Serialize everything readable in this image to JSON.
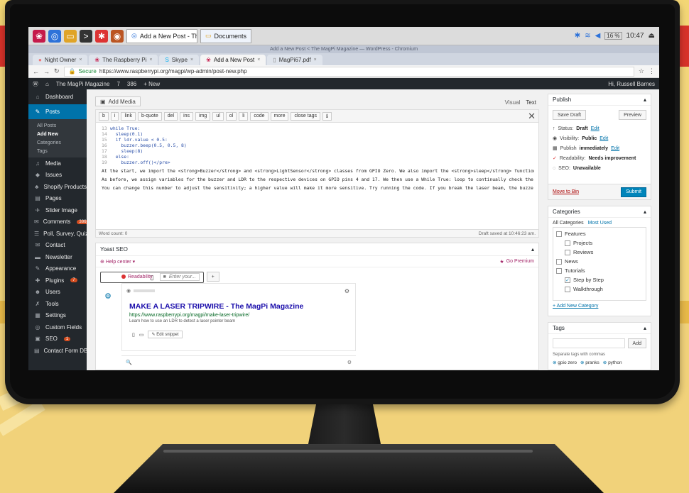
{
  "taskbar": {
    "tasks": [
      "Add a New Post - Th...",
      "Documents"
    ],
    "clock": "10:47",
    "lang": "16 %"
  },
  "browser": {
    "window_title": "Add a New Post < The MagPi Magazine — WordPress - Chromium",
    "tabs": [
      {
        "label": "Night Owner"
      },
      {
        "label": "The Raspberry Pi"
      },
      {
        "label": "Skype"
      },
      {
        "label": "Add a New Post"
      },
      {
        "label": "MagPi67.pdf"
      }
    ],
    "secure_label": "Secure",
    "url": "https://www.raspberrypi.org/magpi/wp-admin/post-new.php"
  },
  "wpbar": {
    "site": "The MagPi Magazine",
    "updates": "7",
    "comments": "386",
    "new": "+ New",
    "greeting": "Hi, Russell Barnes"
  },
  "sidebar": {
    "items": [
      {
        "icon": "⌂",
        "label": "Dashboard"
      },
      {
        "icon": "✎",
        "label": "Posts"
      }
    ],
    "posts_sub": [
      "All Posts",
      "Add New",
      "Categories",
      "Tags"
    ],
    "items2": [
      {
        "icon": "♫",
        "label": "Media"
      },
      {
        "icon": "◆",
        "label": "Issues"
      },
      {
        "icon": "♣",
        "label": "Shopify Products"
      },
      {
        "icon": "▤",
        "label": "Pages"
      },
      {
        "icon": "✈",
        "label": "Slider Image"
      },
      {
        "icon": "✉",
        "label": "Comments",
        "badge": "386"
      },
      {
        "icon": "☰",
        "label": "Poll, Survey, Quiz & Form"
      },
      {
        "icon": "✉",
        "label": "Contact"
      },
      {
        "icon": "▬",
        "label": "Newsletter"
      },
      {
        "icon": "✎",
        "label": "Appearance"
      },
      {
        "icon": "✚",
        "label": "Plugins",
        "badge": "7"
      },
      {
        "icon": "☻",
        "label": "Users"
      },
      {
        "icon": "✗",
        "label": "Tools"
      },
      {
        "icon": "▦",
        "label": "Settings"
      },
      {
        "icon": "◎",
        "label": "Custom Fields"
      },
      {
        "icon": "▣",
        "label": "SEO",
        "badge": "1"
      },
      {
        "icon": "▤",
        "label": "Contact Form DB"
      }
    ]
  },
  "editor": {
    "add_media": "Add Media",
    "tab_visual": "Visual",
    "tab_text": "Text",
    "quicktags": [
      "b",
      "i",
      "link",
      "b-quote",
      "del",
      "ins",
      "img",
      "ul",
      "ol",
      "li",
      "code",
      "more",
      "close tags",
      "ℹ"
    ],
    "code_lines": [
      {
        "n": "13",
        "t": "while True:"
      },
      {
        "n": "14",
        "t": "  sleep(0.1)"
      },
      {
        "n": "15",
        "t": "  if ldr.value < 0.5:"
      },
      {
        "n": "16",
        "t": "    buzzer.beep(0.5, 0.5, 8)"
      },
      {
        "n": "17",
        "t": "    sleep(8)"
      },
      {
        "n": "18",
        "t": "  else:"
      },
      {
        "n": "19",
        "t": "    buzzer.off()</pre>"
      }
    ],
    "para1": "At the start, we import the <strong>Buzzer</strong> and <strong>LightSensor</strong> classes from GPIO Zero. We also import the <strong>sleep</strong> function from time; we'll need this to slow the script down a little to give the capacitor time to charge.",
    "para2": "As before, we assign variables for the buzzer and LDR to the respective devices on GPIO pins 4 and 17. We then use a While True: loop to continually check the light level on the LDR; if it falls below 0.5, we make the buzzer beep.",
    "para3": "You can change this number to adjust the sensitivity; a higher value will make it more sensitive. Try running the code. If you break the laser beam, the buzzer should beep for eight seconds. You can adjust this by altering the buzzer.beep parameters and sleep time.",
    "word_count": "Word count: 0",
    "draft_saved": "Draft saved at 10:46:23 am."
  },
  "yoast": {
    "title": "Yoast SEO",
    "help": "Help center",
    "premium": "Go Premium",
    "readability": "Readability",
    "keyword_placeholder": "Enter your...",
    "snippet_title": "MAKE A LASER TRIPWIRE - The MagPi Magazine",
    "snippet_url": "https://www.raspberrypi.org/magpi/make-laser-tripwire/",
    "snippet_desc": "Learn how to use an LDR to detect a laser pointer beam",
    "edit_snippet": "Edit snippet"
  },
  "publish": {
    "title": "Publish",
    "save_draft": "Save Draft",
    "preview": "Preview",
    "rows": [
      {
        "icon": "↑",
        "k": "Status: ",
        "v": "Draft",
        "edit": "Edit"
      },
      {
        "icon": "◉",
        "k": "Visibility: ",
        "v": "Public",
        "edit": "Edit"
      },
      {
        "icon": "▦",
        "k": "Publish ",
        "v": "immediately",
        "edit": "Edit"
      },
      {
        "icon": "✓",
        "k": "Readability: ",
        "v": "Needs improvement",
        "edit": ""
      },
      {
        "icon": "◌",
        "k": "SEO: ",
        "v": "Unavailable",
        "edit": ""
      }
    ],
    "trash": "Move to Bin",
    "submit": "Submit"
  },
  "categories": {
    "title": "Categories",
    "tab_all": "All Categories",
    "tab_most": "Most Used",
    "items": [
      {
        "label": "Features",
        "indent": false,
        "checked": false
      },
      {
        "label": "Projects",
        "indent": true,
        "checked": false
      },
      {
        "label": "Reviews",
        "indent": true,
        "checked": false
      },
      {
        "label": "News",
        "indent": false,
        "checked": false
      },
      {
        "label": "Tutorials",
        "indent": false,
        "checked": false
      },
      {
        "label": "Step by Step",
        "indent": true,
        "checked": true
      },
      {
        "label": "Walkthrough",
        "indent": true,
        "checked": false
      }
    ],
    "add_new": "+ Add New Category"
  },
  "tags": {
    "title": "Tags",
    "add": "Add",
    "help": "Separate tags with commas",
    "list": [
      "gpio zero",
      "pranks",
      "python"
    ]
  },
  "colors": {
    "wp_blue": "#0073aa",
    "wp_dark": "#23282d",
    "yoast_purple": "#a4286a",
    "frame_red": "#d8322a"
  }
}
